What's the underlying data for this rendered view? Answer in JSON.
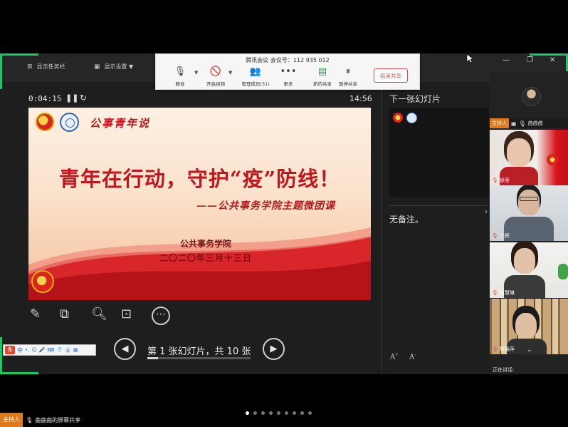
{
  "window": {
    "taskbar_label": "显示任务栏",
    "settings_label": "显示设置 ▼"
  },
  "meeting": {
    "title": "腾讯会议 会议号：112 935 012",
    "buttons": {
      "mute": "静音",
      "video": "开启视频",
      "members": "管理成员(31)",
      "more": "更多",
      "new_share": "新的共享",
      "pause_share": "暂停共享",
      "end_share": "结束共享"
    }
  },
  "presenter": {
    "elapsed": "0:04:15",
    "clock": "14:56",
    "next_slide_label": "下一张幻灯片",
    "notes": "无备注。",
    "slide_counter": "第 1 张幻灯片，共 10 张",
    "current_slide": 1,
    "total_slides": 10
  },
  "slide": {
    "brand": "公事青年说",
    "title": "青年在行动，守护“疫”防线！",
    "subtitle": "——公共事务学院主题微团课",
    "org": "公共事务学院",
    "date": "二〇二〇年三月十三日"
  },
  "ime": {
    "logo": "S",
    "mode": "中",
    "items": [
      "•,",
      "☺",
      "🎤",
      "⌨",
      "👕",
      "👔",
      "▦"
    ]
  },
  "participants": {
    "host_badge": "主持人",
    "host_name": "曲曲曲",
    "tiles": [
      {
        "name": "徐莹"
      },
      {
        "name": "三辉"
      },
      {
        "name": "蒋慧琳"
      },
      {
        "name": "陈锦萍"
      }
    ],
    "speaking_label": "正在讲话:"
  },
  "footer": {
    "host_badge": "主持人",
    "share_text": "曲曲曲的屏幕共享",
    "dots_total": 9,
    "dots_active": 0
  },
  "colors": {
    "accent_green": "#17c964",
    "host_orange": "#e07a1d",
    "end_share_red": "#e24c4c",
    "slide_red": "#c3161c"
  }
}
